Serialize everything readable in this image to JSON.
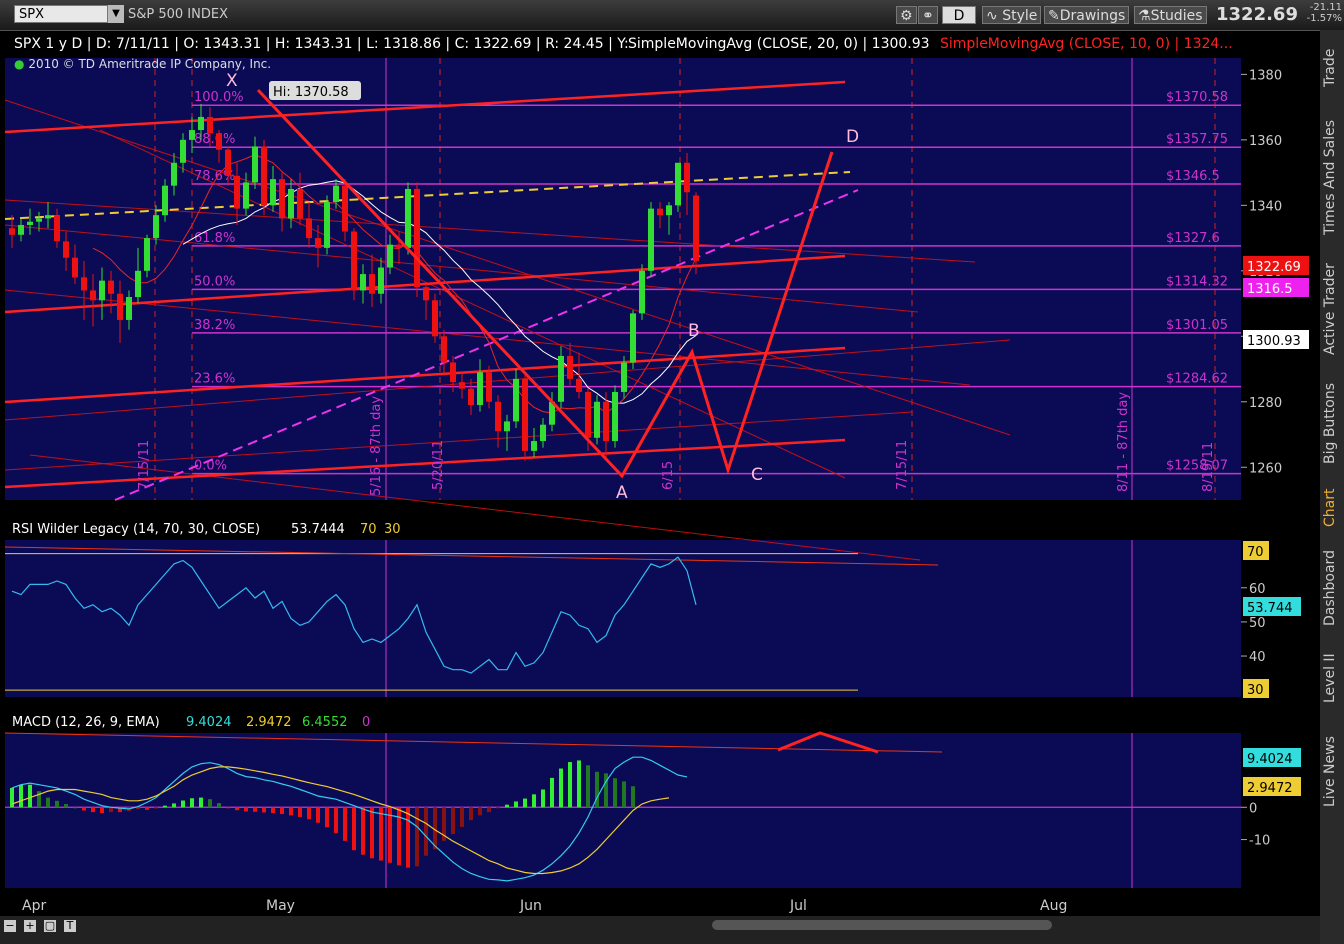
{
  "toolbar": {
    "symbol": "SPX",
    "symbol_name": "S&P 500 INDEX",
    "timeframe_label": "D",
    "style_label": "Style",
    "drawings_label": "Drawings",
    "studies_label": "Studies",
    "last_price": "1322.69",
    "change": "-21.11",
    "change_pct": "-1.57%"
  },
  "side_tabs": [
    "Trade",
    "Times And Sales",
    "Active Trader",
    "Big Buttons",
    "Chart",
    "Dashboard",
    "Level II",
    "Live News"
  ],
  "header": {
    "descriptor": "SPX 1 y D",
    "date": "D: 7/11/11",
    "open": "O: 1343.31",
    "high": "H: 1343.31",
    "low": "L: 1318.86",
    "close": "C: 1322.69",
    "range": "R: 24.45",
    "y": "Y:",
    "sma20_label": "SimpleMovingAvg (CLOSE, 20, 0)",
    "sma20_value": "1300.93",
    "sma10_label": "SimpleMovingAvg (CLOSE, 10, 0)",
    "sma10_value": "1324...",
    "copyright": "2010 © TD Ameritrade IP Company, Inc."
  },
  "colors": {
    "panel_bg": "#0b0b55",
    "grid": "#6a1a7a",
    "bull": "#33dd33",
    "bear": "#ee1111",
    "fib": "#cc33cc",
    "pattern": "#ff2222",
    "rsi": "#33bbee",
    "signal": "#eecc33"
  },
  "chart_data": [
    {
      "type": "candlestick",
      "title": "SPX 1 y D",
      "ylim": [
        1250,
        1385
      ],
      "y_ticks": [
        1260,
        1280,
        1300,
        1320,
        1340,
        1360,
        1380
      ],
      "x_tick_labels": [
        "Apr",
        "May",
        "Jun",
        "Jul",
        "Aug"
      ],
      "hi_label": "Hi: 1370.58",
      "fib_levels": [
        {
          "pct": "100.0%",
          "value": 1370.58,
          "price_label": "$1370.58"
        },
        {
          "pct": "88.6%",
          "value": 1357.75,
          "price_label": "$1357.75"
        },
        {
          "pct": "78.6%",
          "value": 1346.5,
          "price_label": "$1346.5"
        },
        {
          "pct": "61.8%",
          "value": 1327.6,
          "price_label": "$1327.6"
        },
        {
          "pct": "50.0%",
          "value": 1314.32,
          "price_label": "$1314.32"
        },
        {
          "pct": "38.2%",
          "value": 1301.05,
          "price_label": "$1301.05"
        },
        {
          "pct": "23.6%",
          "value": 1284.62,
          "price_label": "$1284.62"
        },
        {
          "pct": "0.0%",
          "value": 1258.07,
          "price_label": "$1258.07"
        }
      ],
      "pattern_points": [
        {
          "label": "X",
          "price": 1370.58
        },
        {
          "label": "A",
          "price": 1262
        },
        {
          "label": "B",
          "price": 1298
        },
        {
          "label": "C",
          "price": 1262
        },
        {
          "label": "D",
          "price": 1356
        }
      ],
      "vertical_labels": [
        "7/15/11",
        "5/16 - 87th day",
        "5/20/11",
        "6/15",
        "7/15/11",
        "8/11 - 87th day",
        "8/19/11"
      ],
      "price_tags": [
        {
          "label": "1322.69",
          "color": "#ee1111"
        },
        {
          "label": "1316.5",
          "color": "#ee22ee"
        },
        {
          "label": "1300.93",
          "color": "#ffffff"
        }
      ],
      "candles": [
        {
          "o": 1333,
          "h": 1337,
          "c": 1331,
          "l": 1327
        },
        {
          "o": 1331,
          "h": 1336,
          "c": 1334,
          "l": 1329
        },
        {
          "o": 1334,
          "h": 1339,
          "c": 1335,
          "l": 1331
        },
        {
          "o": 1335,
          "h": 1338,
          "c": 1336,
          "l": 1332
        },
        {
          "o": 1336,
          "h": 1341,
          "c": 1337,
          "l": 1333
        },
        {
          "o": 1337,
          "h": 1339,
          "c": 1329,
          "l": 1327
        },
        {
          "o": 1329,
          "h": 1332,
          "c": 1324,
          "l": 1320
        },
        {
          "o": 1324,
          "h": 1328,
          "c": 1318,
          "l": 1316
        },
        {
          "o": 1318,
          "h": 1323,
          "c": 1314,
          "l": 1305
        },
        {
          "o": 1314,
          "h": 1319,
          "c": 1311,
          "l": 1303
        },
        {
          "o": 1311,
          "h": 1321,
          "c": 1317,
          "l": 1305
        },
        {
          "o": 1317,
          "h": 1320,
          "c": 1313,
          "l": 1307
        },
        {
          "o": 1313,
          "h": 1317,
          "c": 1305,
          "l": 1298
        },
        {
          "o": 1305,
          "h": 1314,
          "c": 1312,
          "l": 1302
        },
        {
          "o": 1312,
          "h": 1327,
          "c": 1320,
          "l": 1310
        },
        {
          "o": 1320,
          "h": 1331,
          "c": 1330,
          "l": 1318
        },
        {
          "o": 1330,
          "h": 1340,
          "c": 1337,
          "l": 1328
        },
        {
          "o": 1337,
          "h": 1348,
          "c": 1346,
          "l": 1335
        },
        {
          "o": 1346,
          "h": 1356,
          "c": 1353,
          "l": 1343
        },
        {
          "o": 1353,
          "h": 1362,
          "c": 1360,
          "l": 1350
        },
        {
          "o": 1360,
          "h": 1367,
          "c": 1363,
          "l": 1356
        },
        {
          "o": 1363,
          "h": 1371,
          "c": 1367,
          "l": 1360
        },
        {
          "o": 1367,
          "h": 1370,
          "c": 1362,
          "l": 1358
        },
        {
          "o": 1362,
          "h": 1363,
          "c": 1357,
          "l": 1353
        },
        {
          "o": 1357,
          "h": 1358,
          "c": 1349,
          "l": 1346
        },
        {
          "o": 1349,
          "h": 1353,
          "c": 1339,
          "l": 1334
        },
        {
          "o": 1339,
          "h": 1350,
          "c": 1347,
          "l": 1337
        },
        {
          "o": 1347,
          "h": 1361,
          "c": 1358,
          "l": 1345
        },
        {
          "o": 1358,
          "h": 1360,
          "c": 1340,
          "l": 1337
        },
        {
          "o": 1340,
          "h": 1352,
          "c": 1348,
          "l": 1338
        },
        {
          "o": 1348,
          "h": 1350,
          "c": 1336,
          "l": 1332
        },
        {
          "o": 1336,
          "h": 1348,
          "c": 1345,
          "l": 1333
        },
        {
          "o": 1345,
          "h": 1350,
          "c": 1336,
          "l": 1334
        },
        {
          "o": 1336,
          "h": 1341,
          "c": 1330,
          "l": 1327
        },
        {
          "o": 1330,
          "h": 1334,
          "c": 1327,
          "l": 1321
        },
        {
          "o": 1327,
          "h": 1343,
          "c": 1341,
          "l": 1325
        },
        {
          "o": 1341,
          "h": 1348,
          "c": 1346,
          "l": 1339
        },
        {
          "o": 1346,
          "h": 1348,
          "c": 1332,
          "l": 1329
        },
        {
          "o": 1332,
          "h": 1333,
          "c": 1314,
          "l": 1311
        },
        {
          "o": 1314,
          "h": 1322,
          "c": 1319,
          "l": 1310
        },
        {
          "o": 1319,
          "h": 1325,
          "c": 1313,
          "l": 1309
        },
        {
          "o": 1313,
          "h": 1324,
          "c": 1321,
          "l": 1310
        },
        {
          "o": 1321,
          "h": 1331,
          "c": 1328,
          "l": 1319
        },
        {
          "o": 1328,
          "h": 1332,
          "c": 1327,
          "l": 1322
        },
        {
          "o": 1327,
          "h": 1347,
          "c": 1345,
          "l": 1325
        },
        {
          "o": 1345,
          "h": 1347,
          "c": 1315,
          "l": 1312
        },
        {
          "o": 1315,
          "h": 1316,
          "c": 1311,
          "l": 1305
        },
        {
          "o": 1311,
          "h": 1313,
          "c": 1300,
          "l": 1298
        },
        {
          "o": 1300,
          "h": 1302,
          "c": 1292,
          "l": 1288
        },
        {
          "o": 1292,
          "h": 1294,
          "c": 1286,
          "l": 1283
        },
        {
          "o": 1286,
          "h": 1289,
          "c": 1284,
          "l": 1281
        },
        {
          "o": 1284,
          "h": 1287,
          "c": 1279,
          "l": 1276
        },
        {
          "o": 1279,
          "h": 1293,
          "c": 1289,
          "l": 1277
        },
        {
          "o": 1289,
          "h": 1291,
          "c": 1280,
          "l": 1278
        },
        {
          "o": 1280,
          "h": 1282,
          "c": 1271,
          "l": 1266
        },
        {
          "o": 1271,
          "h": 1276,
          "c": 1274,
          "l": 1265
        },
        {
          "o": 1274,
          "h": 1290,
          "c": 1287,
          "l": 1272
        },
        {
          "o": 1287,
          "h": 1288,
          "c": 1265,
          "l": 1262
        },
        {
          "o": 1265,
          "h": 1272,
          "c": 1268,
          "l": 1263
        },
        {
          "o": 1268,
          "h": 1275,
          "c": 1273,
          "l": 1266
        },
        {
          "o": 1273,
          "h": 1283,
          "c": 1280,
          "l": 1271
        },
        {
          "o": 1280,
          "h": 1297,
          "c": 1294,
          "l": 1278
        },
        {
          "o": 1294,
          "h": 1298,
          "c": 1287,
          "l": 1285
        },
        {
          "o": 1287,
          "h": 1295,
          "c": 1283,
          "l": 1281
        },
        {
          "o": 1283,
          "h": 1284,
          "c": 1269,
          "l": 1265
        },
        {
          "o": 1269,
          "h": 1282,
          "c": 1280,
          "l": 1267
        },
        {
          "o": 1280,
          "h": 1283,
          "c": 1268,
          "l": 1263
        },
        {
          "o": 1268,
          "h": 1285,
          "c": 1283,
          "l": 1266
        },
        {
          "o": 1283,
          "h": 1294,
          "c": 1292,
          "l": 1281
        },
        {
          "o": 1292,
          "h": 1308,
          "c": 1307,
          "l": 1290
        },
        {
          "o": 1307,
          "h": 1322,
          "c": 1320,
          "l": 1305
        },
        {
          "o": 1320,
          "h": 1341,
          "c": 1339,
          "l": 1318
        },
        {
          "o": 1339,
          "h": 1341,
          "c": 1337,
          "l": 1333
        },
        {
          "o": 1337,
          "h": 1341,
          "c": 1340,
          "l": 1331
        },
        {
          "o": 1340,
          "h": 1352,
          "c": 1353,
          "l": 1338
        },
        {
          "o": 1353,
          "h": 1356,
          "c": 1344,
          "l": 1337
        },
        {
          "o": 1343,
          "h": 1344,
          "c": 1323,
          "l": 1319
        }
      ]
    },
    {
      "type": "line",
      "title": "RSI Wilder Legacy (14, 70, 30, CLOSE)",
      "value_label": "53.7444",
      "overbought_label": "70",
      "oversold_label": "30",
      "ylim": [
        28,
        74
      ],
      "y_ticks": [
        40,
        50,
        60
      ],
      "level_tags": [
        {
          "label": "70",
          "color": "#eecc33"
        },
        {
          "label": "53.744",
          "color": "#33dddd"
        },
        {
          "label": "30",
          "color": "#eecc33"
        }
      ],
      "values": [
        59,
        58,
        61,
        61,
        61,
        62,
        61,
        57,
        54,
        55,
        53,
        54,
        52,
        49,
        55,
        58,
        61,
        64,
        67,
        68,
        66,
        62,
        58,
        54,
        56,
        58,
        60,
        57,
        59,
        54,
        56,
        51,
        49,
        50,
        53,
        56,
        58,
        55,
        48,
        44,
        45,
        44,
        46,
        48,
        51,
        55,
        47,
        42,
        37,
        36,
        36,
        35,
        37,
        39,
        36,
        36,
        41,
        37,
        38,
        41,
        47,
        53,
        52,
        49,
        48,
        44,
        46,
        52,
        55,
        59,
        63,
        67,
        66,
        67,
        69,
        65,
        55
      ]
    },
    {
      "type": "bar",
      "title": "MACD (12, 26, 9, EMA)",
      "value_label": "9.4024",
      "signal_label": "2.9472",
      "diff_label": "6.4552",
      "zero_label": "0",
      "ylim": [
        -25,
        23
      ],
      "y_ticks": [
        -10,
        0
      ],
      "level_tags": [
        {
          "label": "9.4024",
          "color": "#33dddd"
        },
        {
          "label": "2.9472",
          "color": "#eecc33"
        }
      ],
      "series": [
        {
          "name": "MACD",
          "values": [
            6,
            7,
            7.5,
            7,
            6.5,
            6,
            5,
            4,
            2.5,
            1.5,
            0.5,
            0,
            -0.3,
            -0.5,
            0.2,
            1.5,
            3,
            5.5,
            8,
            10.5,
            12.5,
            13.5,
            13.8,
            13.2,
            12,
            10.5,
            9.5,
            9.2,
            8.5,
            8,
            7.2,
            6.5,
            5.5,
            4.5,
            3.5,
            3,
            2.5,
            1.5,
            0.5,
            -0.5,
            -1.5,
            -2,
            -2.5,
            -3,
            -4,
            -6,
            -9,
            -12,
            -14.5,
            -17,
            -19,
            -20.5,
            -21.5,
            -22.3,
            -22.5,
            -22.8,
            -22.3,
            -21.8,
            -21,
            -19.5,
            -17.5,
            -15,
            -12,
            -8,
            -3,
            3,
            8,
            12,
            14,
            15.5,
            15.5,
            14.5,
            13,
            11.5,
            10,
            9.4
          ]
        },
        {
          "name": "Signal",
          "values": [
            1,
            2,
            3,
            4,
            5,
            5.5,
            5.5,
            5.5,
            5,
            4.5,
            4,
            3,
            2.5,
            2,
            2,
            2.5,
            3.5,
            5,
            6.5,
            8.5,
            10,
            11,
            12,
            12.5,
            12.5,
            12.2,
            11.8,
            11.3,
            10.8,
            10.2,
            9.7,
            9,
            8.3,
            7.6,
            7,
            6.4,
            5.6,
            4.8,
            4,
            3,
            2,
            1,
            0.2,
            -0.8,
            -2,
            -3.5,
            -5,
            -7,
            -8.7,
            -10.5,
            -12,
            -13.5,
            -15,
            -16.5,
            -17.5,
            -18.8,
            -19.5,
            -20.2,
            -20.5,
            -20.5,
            -20.2,
            -19.7,
            -18.8,
            -17.5,
            -15.5,
            -13,
            -10,
            -7,
            -4,
            -1,
            1,
            2,
            2.5,
            2.9
          ]
        },
        {
          "name": "Diff",
          "values": [
            6,
            7,
            7,
            5,
            3,
            2,
            1,
            0,
            -1,
            -1.5,
            -1.8,
            -1.5,
            -1.5,
            -1.2,
            -0.6,
            -0.8,
            -0.4,
            0.5,
            1.2,
            2.1,
            2.8,
            3,
            2.5,
            1.3,
            -0.2,
            -0.9,
            -1.3,
            -1.4,
            -1.6,
            -1.8,
            -2.1,
            -2.5,
            -3,
            -3.7,
            -4.8,
            -6.2,
            -8,
            -10.4,
            -13.3,
            -14.7,
            -15.8,
            -16.5,
            -17.2,
            -18,
            -18.7,
            -18.3,
            -15,
            -13,
            -10.4,
            -8.3,
            -6.1,
            -4,
            -2.5,
            -1.5,
            -0.3,
            0.8,
            1.8,
            2.7,
            4,
            5.5,
            9.1,
            12,
            14,
            14.5,
            13,
            11,
            10.5,
            9,
            8,
            6.5
          ]
        }
      ]
    }
  ]
}
